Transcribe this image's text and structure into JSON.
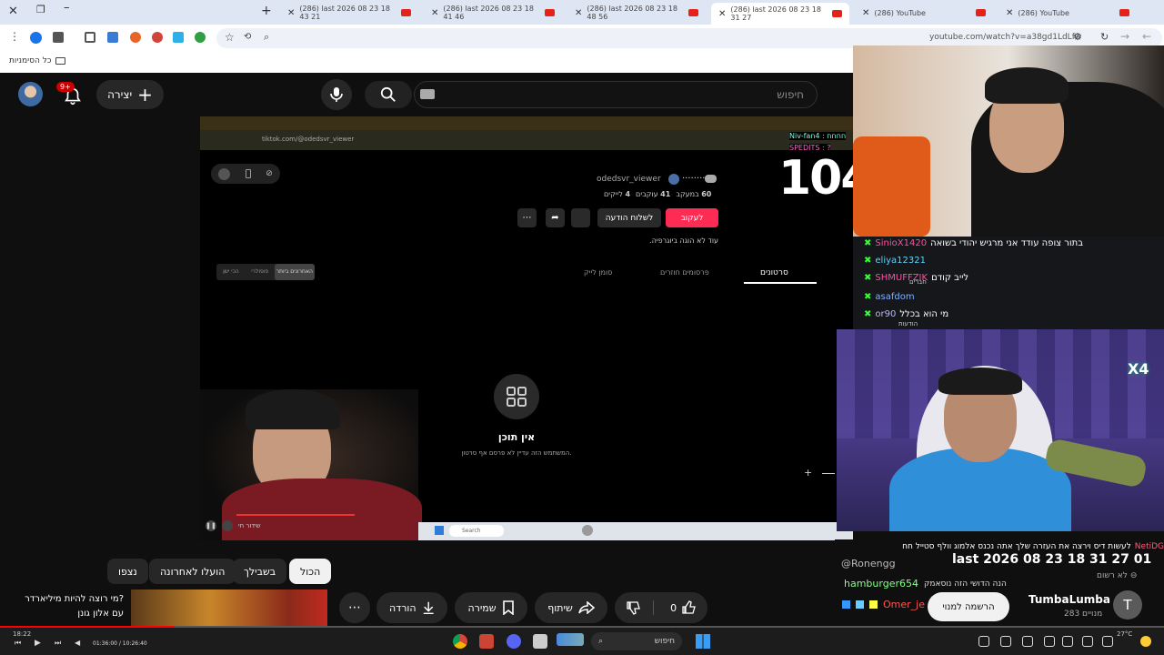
{
  "tabs": [
    {
      "label": "(286) last 2026 08 23 18 43 21",
      "active": false
    },
    {
      "label": "(286) last 2026 08 23 18 41 46",
      "active": false
    },
    {
      "label": "(286) last 2026 08 23 18 48 56",
      "active": false
    },
    {
      "label": "(286) last 2026 08 23 18 31 27",
      "active": true
    },
    {
      "label": "(286) YouTube",
      "active": false
    },
    {
      "label": "(286) YouTube",
      "active": false
    }
  ],
  "address": {
    "url": "youtube.com/watch?v=a38gd1LdLfw"
  },
  "bookmarks": {
    "all_label": "כל הסימניות"
  },
  "header": {
    "search_placeholder": "חיפוש",
    "create_label": "יצירה",
    "notif_count": "9+"
  },
  "video": {
    "inner_url": "tiktok.com/@odedsvr_viewer",
    "big_number": "104",
    "profile_username": "odedsvr_viewer",
    "profile_name": "........",
    "stats": {
      "following": "60",
      "following_label": "במעקב",
      "followers": "41",
      "followers_label": "עוקבים",
      "likes": "4",
      "likes_label": "לייקים"
    },
    "follow_label": "לעקוב",
    "message_label": "לשלוח הודעה",
    "no_bio": "עוד לא הוגה ביוגרפיה.",
    "tabs": [
      "סרטונים",
      "פרסומים חוזרים",
      "סומן לייק"
    ],
    "sort_options": [
      "האחרונים ביותר",
      "פופולרי",
      "הכי ישן"
    ],
    "empty_title": "אין תוכן",
    "empty_sub": "המשתמש הזה עדיין לא פרסם אף סרטון.",
    "overlay_tiny": "שידור חי",
    "search_label": "Search",
    "time_current": "01:36:00",
    "time_total": "10:26:40",
    "clock": "18:22",
    "progress_fraction": 0.15
  },
  "chat": [
    {
      "user": "SinioX1420",
      "text": "בתור צופה עודד אני מרגיש יהודי בשואה",
      "color": "#ff4fa3"
    },
    {
      "user": "eliya12321",
      "text": "",
      "color": "#5cd3ff"
    },
    {
      "user": "SHMUFFZIK",
      "text": "לייב קודם",
      "color": "#ff4fa3"
    },
    {
      "user": "asafdom",
      "text": "",
      "color": "#7fb2ff"
    },
    {
      "user": "or90",
      "text": "מי הוא בכלל",
      "color": "#b8b8ff"
    }
  ],
  "chat_sublabels": {
    "friends": "חברים",
    "messages": "הודעות",
    "n4": "Niv-fan4 : חחחח",
    "sped": "SPEDITS : ?"
  },
  "webcam": {
    "multiplier": "X4"
  },
  "filters": [
    "הכול",
    "בשבילך",
    "הועלו לאחרונה",
    "נצפו"
  ],
  "actions": {
    "like_count": "0",
    "share_label": "שיתוף",
    "save_label": "שמירה",
    "download_label": "הורדה"
  },
  "recommended": {
    "title_line1": "מי רוצה להיות מיליארדר?",
    "title_line2": "עם אלון גונן"
  },
  "lower_chat": {
    "top_text": "לעשות דיס וירצה את העזרה שלך אתה נכנס אלמוג וולף סטייל חח",
    "netidg": "NetiDG",
    "ronen": "@Ronengg",
    "overlay_title": "last 2026 08 23 18 31 27 01",
    "not_rated": "לא רשום",
    "hamburger": "hamburger654",
    "hamburger_text": "הנה הדושי הזה נוסאמק",
    "omer": "Omer_je",
    "channel_name": "TumbaLumba",
    "subs": "283 מנויים",
    "subscribe_label": "הרשמה למנוי",
    "avatar_letter": "T"
  },
  "taskbar": {
    "search_label": "חיפוש",
    "temp": "27°C"
  }
}
